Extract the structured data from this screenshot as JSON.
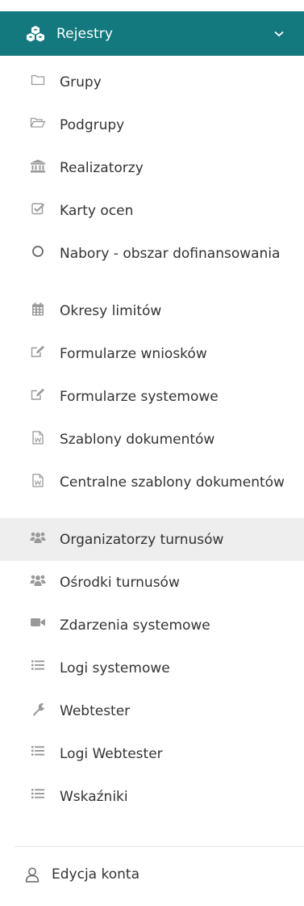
{
  "section": {
    "label": "Rejestry",
    "icon": "cubes-icon",
    "chevron": "chevron-down-icon",
    "color": "#13797e"
  },
  "menu": {
    "items": [
      {
        "label": "Grupy",
        "icon": "folder-icon"
      },
      {
        "label": "Podgrupy",
        "icon": "folder-open-icon"
      },
      {
        "label": "Realizatorzy",
        "icon": "bank-icon"
      },
      {
        "label": "Karty ocen",
        "icon": "checkbox-icon"
      },
      {
        "label": "Nabory - obszar dofinansowania",
        "icon": "circle-icon"
      },
      {
        "label": "Okresy limitów",
        "icon": "calendar-icon"
      },
      {
        "label": "Formularze wniosków",
        "icon": "edit-icon"
      },
      {
        "label": "Formularze systemowe",
        "icon": "edit-icon"
      },
      {
        "label": "Szablony dokumentów",
        "icon": "word-file-icon"
      },
      {
        "label": "Centralne szablony dokumentów",
        "icon": "word-file-icon"
      },
      {
        "label": "Organizatorzy turnusów",
        "icon": "users-icon",
        "active": true
      },
      {
        "label": "Ośrodki turnusów",
        "icon": "users-icon"
      },
      {
        "label": "Zdarzenia systemowe",
        "icon": "video-camera-icon"
      },
      {
        "label": "Logi systemowe",
        "icon": "list-icon"
      },
      {
        "label": "Webtester",
        "icon": "wrench-icon"
      },
      {
        "label": "Logi Webtester",
        "icon": "list-icon"
      },
      {
        "label": "Wskaźniki",
        "icon": "list-icon"
      }
    ]
  },
  "account": {
    "label": "Edycja konta",
    "icon": "user-icon"
  }
}
